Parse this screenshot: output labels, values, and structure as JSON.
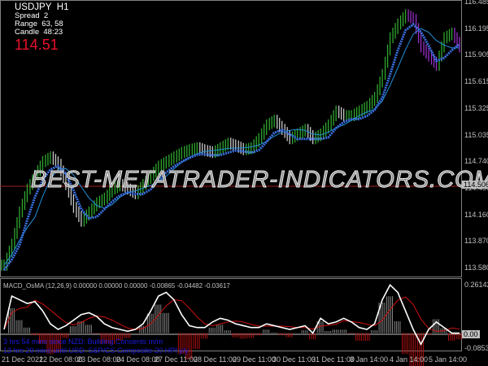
{
  "symbol": "USDJPY",
  "timeframe": "H1",
  "info": {
    "spread_label": "Spread",
    "spread": "2",
    "range_label": "Range",
    "range": "63, 58",
    "candle_label": "Candle",
    "candle": "48:23",
    "price": "114.51"
  },
  "watermark": "BEST-METATRADER-INDICATORS.COM",
  "price_axis": [
    "116.485",
    "116.195",
    "115.905",
    "115.615",
    "115.325",
    "115.035",
    "114.740",
    "114.450",
    "114.160",
    "113.870",
    "113.580"
  ],
  "current_price_tag": "114.506",
  "macd": {
    "label": "MACD_OsMA (12,26,9) 0.00000 0.00000 0.00000 -0.00865 -0.04482 -0.03617",
    "axis": [
      "0.26142",
      "0.00",
      "-0.08532"
    ]
  },
  "news": [
    "3 hrs 54 mins since NZD: Building Consents m/m",
    "13 hrs 20 mins until USD: S&P/CS Composite-20 HPI y/y"
  ],
  "time_axis": [
    "21 Dec 2021",
    "22 Dec 08:00",
    "23 Dec 08:00",
    "24 Dec 08:00",
    "27 Dec 11:00",
    "28 Dec 11:00",
    "29 Dec 11:00",
    "30 Dec 11:00",
    "31 Dec 11:00",
    "3 Jan 14:00",
    "4 Jan 14:00",
    "5 Jan 14:00"
  ],
  "colors": {
    "bull": "#2fa82f",
    "bear": "#9b2fc8",
    "ma": "#3a6fe0",
    "ma2": "#1e8fd8",
    "macd": "#ffffff",
    "signal": "#d01010",
    "price": "#e8102a"
  },
  "chart_data": {
    "type": "line",
    "closes": [
      113.62,
      113.85,
      114.2,
      114.45,
      114.6,
      114.75,
      114.8,
      114.72,
      114.5,
      114.25,
      114.1,
      114.2,
      114.3,
      114.35,
      114.45,
      114.5,
      114.45,
      114.4,
      114.5,
      114.6,
      114.7,
      114.75,
      114.8,
      114.85,
      114.88,
      114.9,
      114.87,
      114.85,
      114.9,
      114.95,
      114.92,
      114.88,
      114.9,
      115.0,
      115.15,
      115.2,
      115.1,
      115.0,
      115.05,
      115.1,
      115.0,
      115.05,
      115.15,
      115.3,
      115.25,
      115.25,
      115.3,
      115.35,
      115.45,
      115.7,
      116.1,
      116.25,
      116.35,
      116.3,
      116.0,
      115.9,
      115.8,
      116.1,
      116.15,
      116.0
    ],
    "ylim": [
      113.5,
      116.5
    ],
    "macd": [
      0.02,
      0.2,
      0.18,
      0.16,
      0.17,
      0.12,
      0.05,
      0.02,
      0.04,
      0.07,
      0.1,
      0.11,
      0.09,
      0.05,
      0.03,
      0.02,
      0.01,
      0.02,
      0.05,
      0.12,
      0.2,
      0.22,
      0.18,
      0.1,
      0.04,
      0.03,
      0.03,
      0.06,
      0.08,
      0.07,
      0.05,
      0.04,
      0.03,
      0.03,
      0.05,
      0.04,
      0.03,
      0.02,
      0.03,
      0.04,
      0.0,
      0.08,
      0.05,
      0.06,
      0.08,
      0.06,
      0.03,
      0.02,
      0.05,
      0.18,
      0.26,
      0.22,
      0.12,
      0.02,
      -0.06,
      0.02,
      0.06,
      0.03,
      0.0,
      0.0
    ],
    "macd_ylim": [
      -0.08532,
      0.26142
    ]
  }
}
